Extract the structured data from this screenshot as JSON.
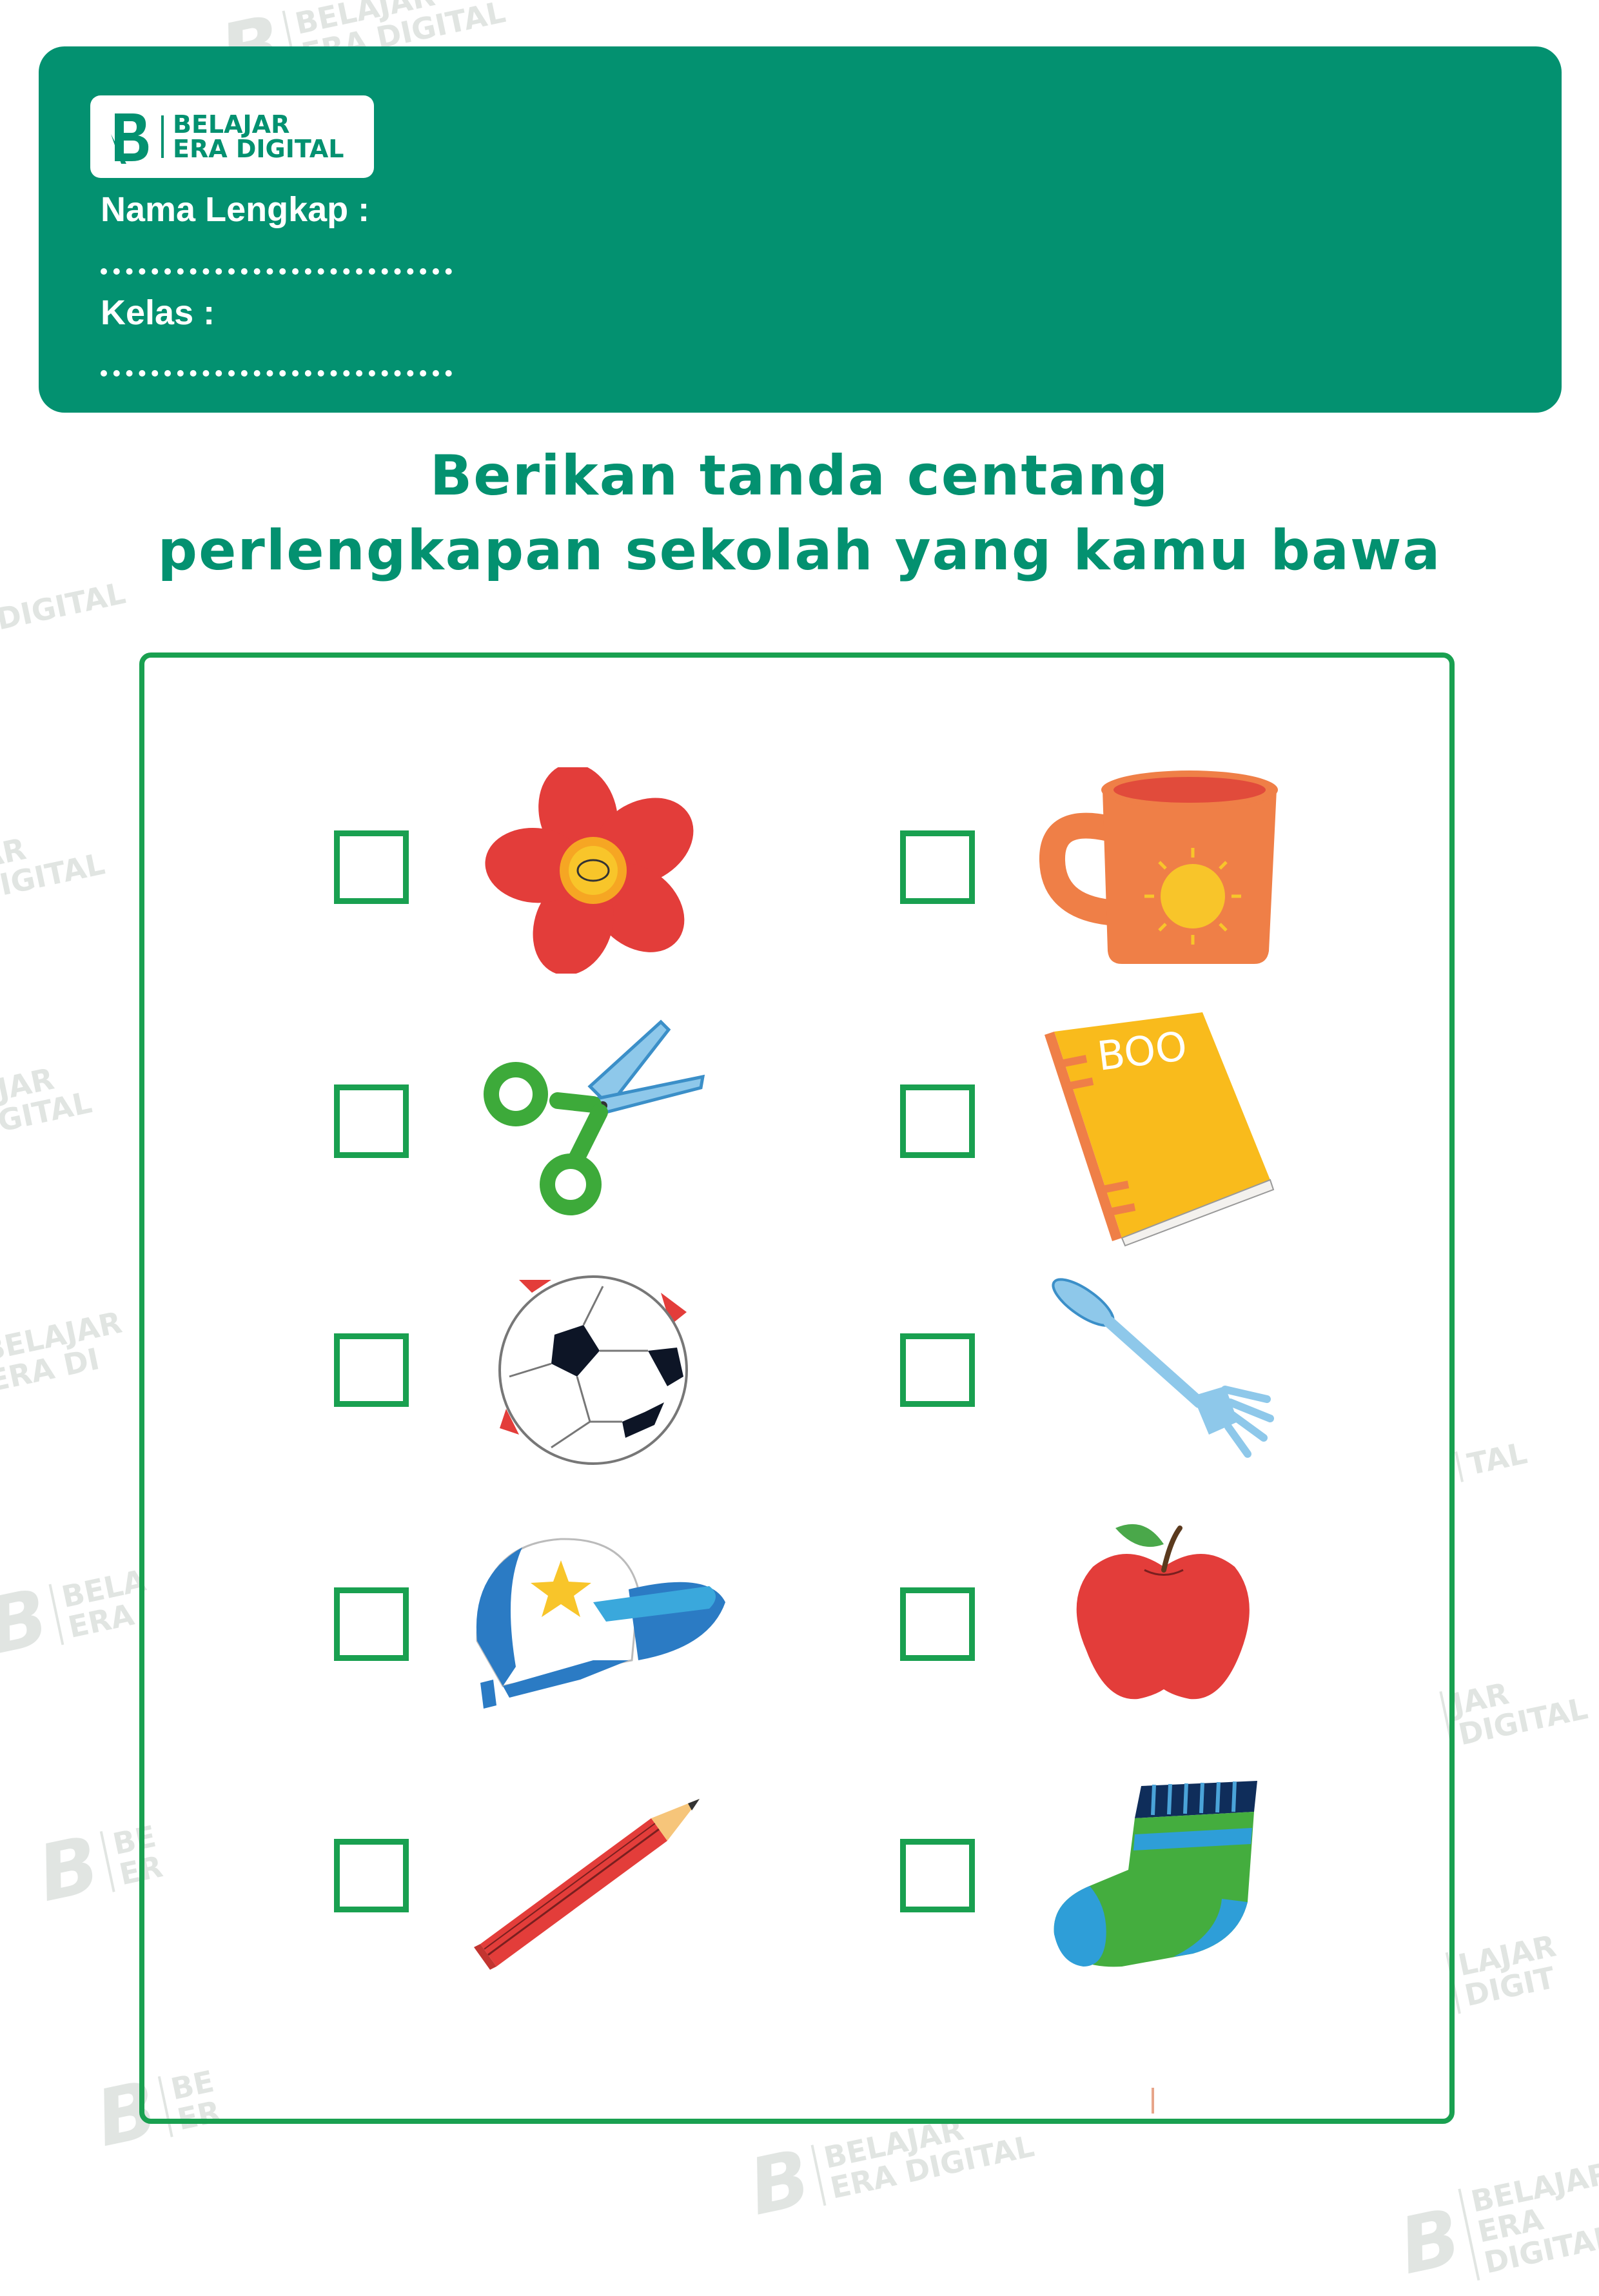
{
  "brand": {
    "line1": "BELAJAR",
    "line2": "ERA DIGITAL",
    "mark_letter": "B"
  },
  "header": {
    "name_label": "Nama Lengkap :",
    "class_label": "Kelas :"
  },
  "instruction": {
    "line1": "Berikan tanda centang",
    "line2": "perlengkapan sekolah yang kamu bawa"
  },
  "colors": {
    "header_green": "#039170",
    "checkbox_green": "#19a050",
    "title_green": "#039170"
  },
  "items": [
    {
      "name": "flower-icon",
      "checked": false
    },
    {
      "name": "mug-icon",
      "checked": false
    },
    {
      "name": "scissors-icon",
      "checked": false
    },
    {
      "name": "book-icon",
      "checked": false,
      "cover_text": "BOO"
    },
    {
      "name": "soccer-ball-icon",
      "checked": false
    },
    {
      "name": "fork-icon",
      "checked": false
    },
    {
      "name": "cap-icon",
      "checked": false
    },
    {
      "name": "apple-icon",
      "checked": false
    },
    {
      "name": "pencil-icon",
      "checked": false
    },
    {
      "name": "sock-icon",
      "checked": false
    }
  ]
}
